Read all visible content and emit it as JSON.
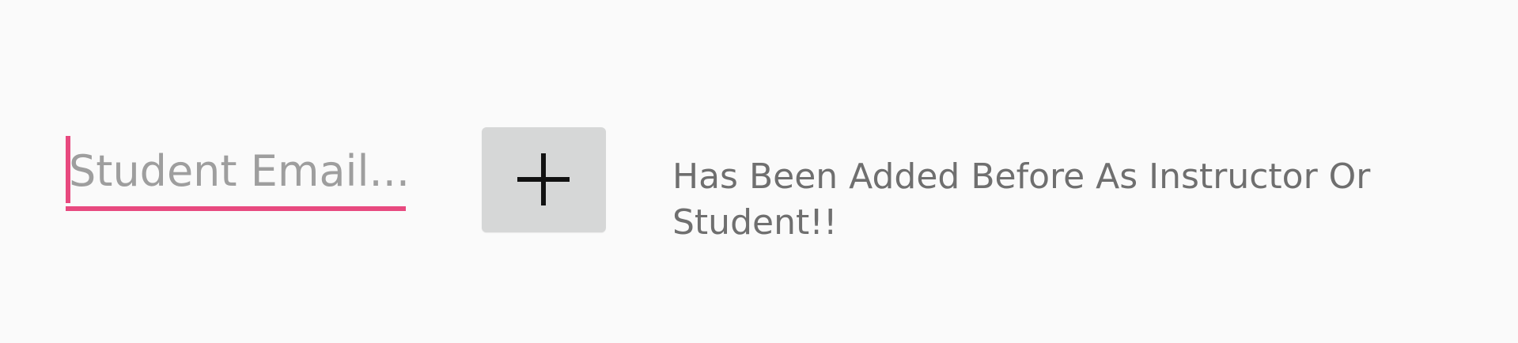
{
  "student_email": {
    "placeholder": "Student Email...",
    "value": "",
    "accent_color": "#e8497f"
  },
  "add_button": {
    "icon": "plus-icon"
  },
  "status_message": {
    "text": "Has Been Added Before As Instructor Or Student!!"
  }
}
